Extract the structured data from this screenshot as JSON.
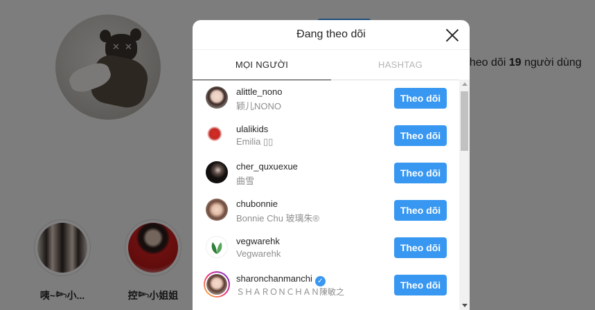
{
  "background": {
    "stats_prefix": "g theo dõi",
    "stats_count": "19",
    "stats_suffix": "người dùng",
    "highlights": [
      {
        "label": "咦~𓆸小..."
      },
      {
        "label": "控𓆸小姐姐"
      }
    ]
  },
  "modal": {
    "title": "Đang theo dõi",
    "tabs": [
      {
        "label": "MỌI NGƯỜI",
        "active": true
      },
      {
        "label": "HASHTAG",
        "active": false
      }
    ],
    "users": [
      {
        "username": "alittle_nono",
        "fullname": "颖儿NONO",
        "button": "Theo dõi",
        "verified": false
      },
      {
        "username": "ulalikids",
        "fullname": "Emilia ▯▯",
        "button": "Theo dõi",
        "verified": false
      },
      {
        "username": "cher_quxuexue",
        "fullname": "曲雪",
        "button": "Theo dõi",
        "verified": false
      },
      {
        "username": "chubonnie",
        "fullname": "Bonnie Chu 玻璃朱®",
        "button": "Theo dõi",
        "verified": false
      },
      {
        "username": "vegwarehk",
        "fullname": "Vegwarehk",
        "button": "Theo dõi",
        "verified": false
      },
      {
        "username": "sharonchanmanchi",
        "fullname": "ＳＨＡＲＯＮＣＨＡＮ陳敏之",
        "button": "Theo dõi",
        "verified": true
      }
    ]
  },
  "colors": {
    "accent": "#3897f0",
    "overlay": "rgba(0,0,0,0.5)"
  }
}
